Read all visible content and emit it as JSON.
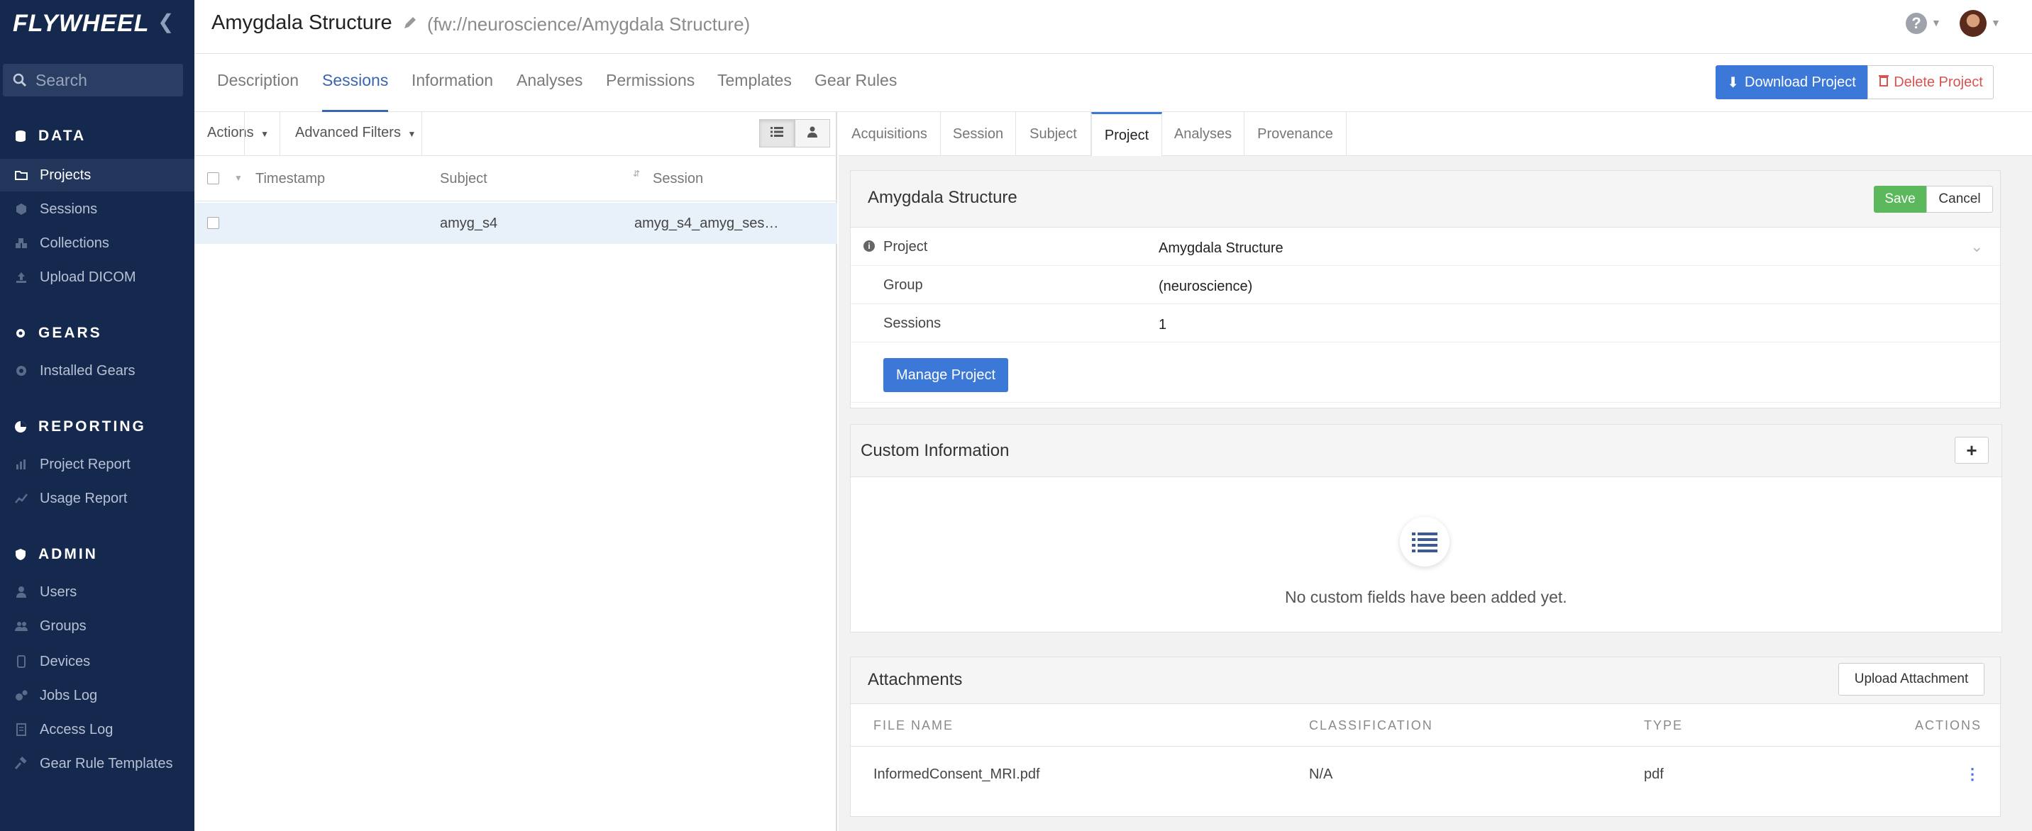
{
  "sidebar": {
    "logo": "FLYWHEEL",
    "search_placeholder": "Search",
    "sections": {
      "data": "DATA",
      "gears": "GEARS",
      "reporting": "REPORTING",
      "admin": "ADMIN"
    },
    "items": {
      "projects": "Projects",
      "sessions": "Sessions",
      "collections": "Collections",
      "upload_dicom": "Upload DICOM",
      "installed_gears": "Installed Gears",
      "project_report": "Project Report",
      "usage_report": "Usage Report",
      "users": "Users",
      "groups": "Groups",
      "devices": "Devices",
      "jobs_log": "Jobs Log",
      "access_log": "Access Log",
      "gear_rule_templates": "Gear Rule Templates"
    }
  },
  "header": {
    "title": "Amygdala Structure",
    "path": "(fw://neuroscience/Amygdala Structure)",
    "help": "?"
  },
  "tabs": {
    "description": "Description",
    "sessions": "Sessions",
    "information": "Information",
    "analyses": "Analyses",
    "permissions": "Permissions",
    "templates": "Templates",
    "gear_rules": "Gear Rules"
  },
  "actions": {
    "download": "Download Project",
    "delete": "Delete Project"
  },
  "list": {
    "actions": "Actions",
    "advanced_filters": "Advanced Filters",
    "columns": {
      "timestamp": "Timestamp",
      "subject": "Subject",
      "session": "Session"
    },
    "row": {
      "timestamp": "",
      "subject": "amyg_s4",
      "session": "amyg_s4_amyg_ses…"
    }
  },
  "detail_tabs": {
    "acquisitions": "Acquisitions",
    "session": "Session",
    "subject": "Subject",
    "project": "Project",
    "analyses": "Analyses",
    "provenance": "Provenance"
  },
  "project_card": {
    "title": "Amygdala Structure",
    "save": "Save",
    "cancel": "Cancel",
    "rows": {
      "project_label": "Project",
      "project_value": "Amygdala Structure",
      "group_label": "Group",
      "group_value": "(neuroscience)",
      "sessions_label": "Sessions",
      "sessions_value": "1"
    },
    "manage": "Manage Project"
  },
  "custom_info": {
    "title": "Custom Information",
    "add": "+",
    "empty": "No custom fields have been added yet."
  },
  "attachments": {
    "title": "Attachments",
    "upload": "Upload Attachment",
    "columns": {
      "file_name": "FILE NAME",
      "classification": "CLASSIFICATION",
      "type": "TYPE",
      "actions": "ACTIONS"
    },
    "row": {
      "file_name": "InformedConsent_MRI.pdf",
      "classification": "N/A",
      "type": "pdf"
    }
  },
  "colors": {
    "sidebar_bg": "#15294f",
    "accent": "#3c78d8",
    "success": "#5cb85c",
    "danger": "#d9534f"
  }
}
